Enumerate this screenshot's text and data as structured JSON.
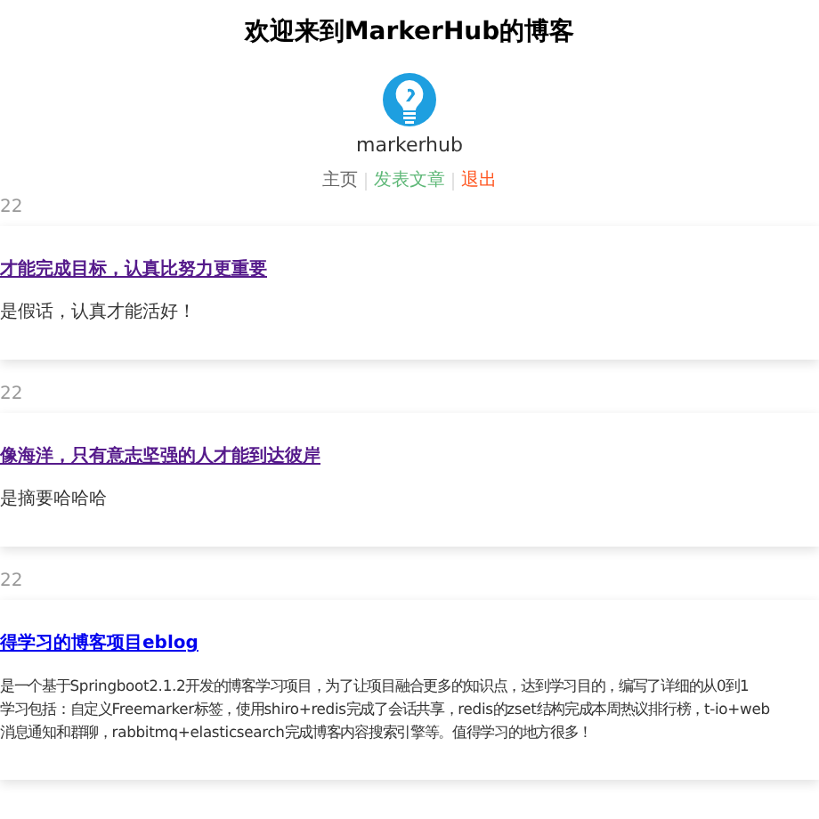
{
  "header": {
    "title": "欢迎来到MarkerHub的博客",
    "username": "markerhub"
  },
  "nav": [
    {
      "label": "主页",
      "color": "#666666"
    },
    {
      "label": "发表文章",
      "color": "#5fb878"
    },
    {
      "label": "退出",
      "color": "#ff5722"
    }
  ],
  "posts": [
    {
      "date": "22",
      "title": "才能完成目标，认真比努力更重要",
      "visited": true,
      "summary": [
        "是假话，认真才能活好！"
      ]
    },
    {
      "date": "22",
      "title": "像海洋，只有意志坚强的人才能到达彼岸",
      "visited": true,
      "summary": [
        "是摘要哈哈哈"
      ]
    },
    {
      "date": "22",
      "title": "得学习的博客项目eblog",
      "visited": false,
      "summary": [
        "是一个基于Springboot2.1.2开发的博客学习项目，为了让项目融合更多的知识点，达到学习目的，编写了详细的从0到1",
        "学习包括：自定义Freemarker标签，使用shiro+redis完成了会话共享，redis的zset结构完成本周热议排行榜，t-io+web",
        "消息通知和群聊，rabbitmq+elasticsearch完成博客内容搜索引擎等。值得学习的地方很多！"
      ]
    }
  ]
}
